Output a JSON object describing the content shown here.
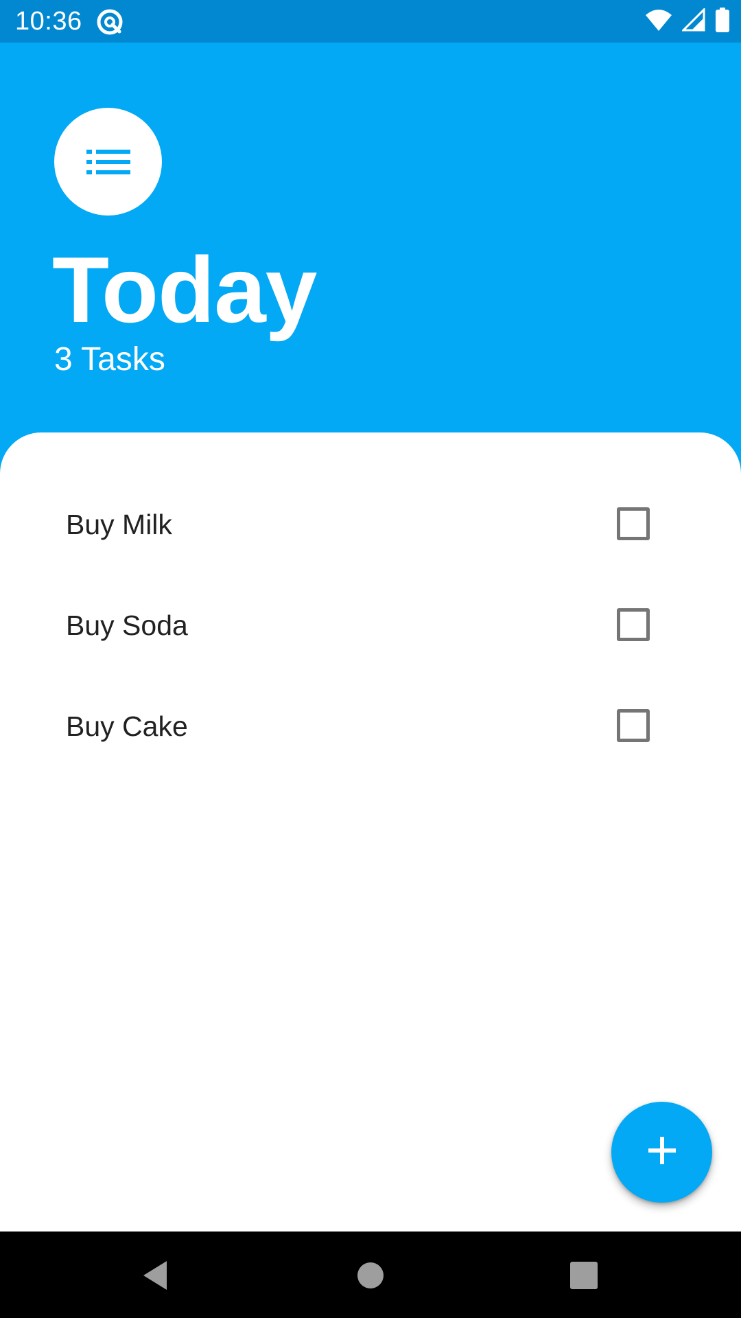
{
  "status_bar": {
    "time": "10:36"
  },
  "header": {
    "title": "Today",
    "task_count": "3 Tasks"
  },
  "tasks": [
    {
      "label": "Buy Milk",
      "checked": false
    },
    {
      "label": "Buy Soda",
      "checked": false
    },
    {
      "label": "Buy Cake",
      "checked": false
    }
  ],
  "icons": {
    "list_avatar": "list-icon",
    "fab": "plus-icon",
    "nav_back": "back-triangle-icon",
    "nav_home": "home-circle-icon",
    "nav_recents": "recents-square-icon"
  },
  "colors": {
    "primary": "#03A9F4",
    "status_bar": "#0288D1",
    "text": "#212121",
    "checkbox_border": "#757575"
  }
}
